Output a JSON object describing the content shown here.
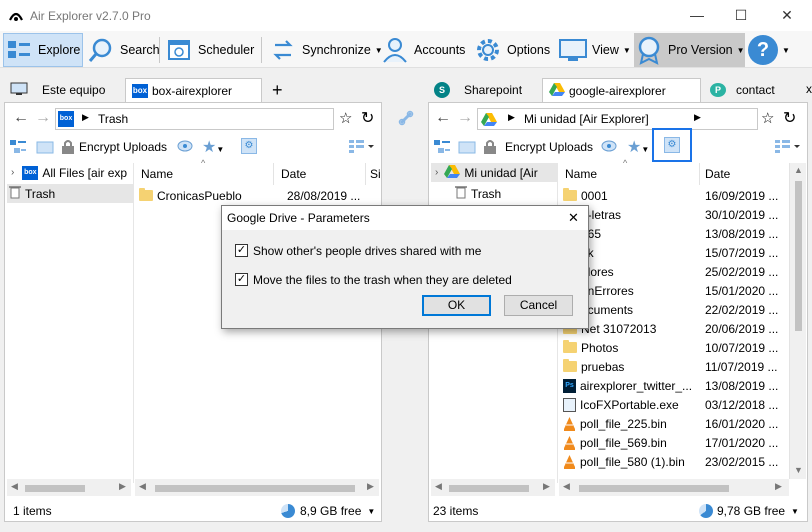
{
  "window": {
    "title": "Air Explorer v2.7.0 Pro",
    "min": "—",
    "max": "☐",
    "close": "✕"
  },
  "toolbar": {
    "explore": "Explore",
    "search": "Search",
    "scheduler": "Scheduler",
    "synchronize": "Synchronize",
    "accounts": "Accounts",
    "options": "Options",
    "view": "View",
    "pro": "Pro Version",
    "help": "?"
  },
  "left": {
    "tabs": [
      "Este equipo",
      "box-airexplorer"
    ],
    "add_tab": "+",
    "path": "Trash",
    "encrypt": "Encrypt Uploads",
    "tree": [
      "All Files [air exp",
      "Trash"
    ],
    "columns": [
      "Name",
      "Date",
      "Si"
    ],
    "files": [
      {
        "name": "CronicasPueblo",
        "date": "28/08/2019 ..."
      }
    ],
    "status_items": "1 items",
    "free": "8,9 GB free"
  },
  "right": {
    "tabs": [
      "Sharepoint",
      "google-airexplorer",
      "contact"
    ],
    "tab_close": "x",
    "path": "Mi unidad [Air Explorer]",
    "encrypt": "Encrypt Uploads",
    "tree": [
      "Mi unidad [Air",
      "Trash"
    ],
    "columns": [
      "Name",
      "Date"
    ],
    "files": [
      {
        "name": "0001",
        "date": "16/09/2019 ...",
        "type": "folder"
      },
      {
        "name": "1-letras",
        "date": "30/10/2019 ...",
        "type": "folder"
      },
      {
        "name": "565",
        "date": "13/08/2019 ...",
        "type": "folder"
      },
      {
        "name": "ak",
        "date": "15/07/2019 ...",
        "type": "folder"
      },
      {
        "name": "olores",
        "date": "25/02/2019 ...",
        "type": "folder"
      },
      {
        "name": "onErrores",
        "date": "15/01/2020 ...",
        "type": "folder"
      },
      {
        "name": "ocuments",
        "date": "22/02/2019 ...",
        "type": "folder"
      },
      {
        "name": "Net 31072013",
        "date": "20/06/2019 ...",
        "type": "folder"
      },
      {
        "name": "Photos",
        "date": "10/07/2019 ...",
        "type": "folder"
      },
      {
        "name": "pruebas",
        "date": "11/07/2019 ...",
        "type": "folder"
      },
      {
        "name": "airexplorer_twitter_...",
        "date": "13/08/2019 ...",
        "type": "psd"
      },
      {
        "name": "IcoFXPortable.exe",
        "date": "03/12/2018 ...",
        "type": "exe"
      },
      {
        "name": "poll_file_225.bin",
        "date": "16/01/2020 ...",
        "type": "bin"
      },
      {
        "name": "poll_file_569.bin",
        "date": "17/01/2020 ...",
        "type": "bin"
      },
      {
        "name": "poll_file_580 (1).bin",
        "date": "23/02/2015 ...",
        "type": "bin"
      }
    ],
    "status_items": "23 items",
    "free": "9,78 GB free"
  },
  "dialog": {
    "title": "Google Drive - Parameters",
    "close": "✕",
    "option1": "Show other's people drives shared with me",
    "option2": "Move the files to the trash when they are deleted",
    "ok": "OK",
    "cancel": "Cancel"
  },
  "colors": {
    "accent": "#0078d7",
    "folder": "#f5d272",
    "highlight": "#1a73e8"
  }
}
